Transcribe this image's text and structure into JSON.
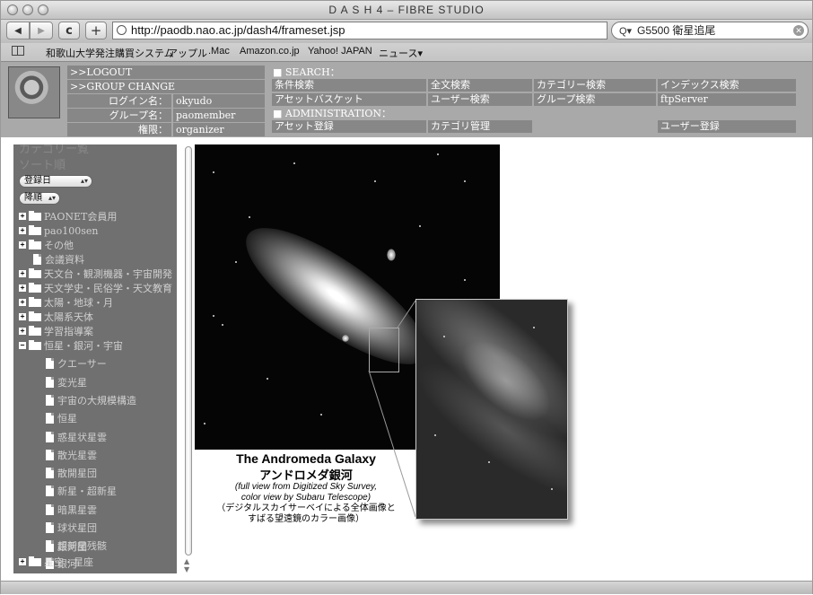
{
  "window": {
    "title": "D A S H 4 – FIBRE STUDIO"
  },
  "toolbar": {
    "back": "◀",
    "forward": "▶",
    "reload": "c",
    "add": "+",
    "url": "http://paodb.nao.ac.jp/dash4/frameset.jsp",
    "search_value": "G5500  衛星追尾"
  },
  "bookmarks": [
    "和歌山大学発注購買システム",
    "アップル",
    ".Mac",
    "Amazon.co.jp",
    "Yahoo! JAPAN",
    "ニュース▾"
  ],
  "user": {
    "logout": ">>LOGOUT",
    "group_change": ">>GROUP CHANGE",
    "login_label": "ログイン名：",
    "login_value": "okyudo",
    "group_label": "グループ名：",
    "group_value": "paomember",
    "role_label": "権限：",
    "role_value": "organizer"
  },
  "menu": {
    "search_title": "■ SEARCH：",
    "search_items": [
      "条件検索",
      "全文検索",
      "カテゴリー検索",
      "インデックス検索",
      "アセットバスケット",
      "ユーザー検索",
      "グループ検索",
      "ftpServer"
    ],
    "admin_title": "■ ADMINISTRATION：",
    "admin_items": [
      "アセット登録",
      "カテゴリ管理",
      "ユーザー登録"
    ]
  },
  "sidebar": {
    "heading1": "カテゴリー覧",
    "heading2": "ソート順",
    "sort_field": "登録日",
    "sort_order": "降順",
    "tree": [
      "PAONET会員用",
      "pao100sen",
      "その他",
      "会議資料",
      "天文台・観測機器・宇宙開発",
      "天文学史・民俗学・天文教育",
      "太陽・地球・月",
      "太陽系天体",
      "学習指導案",
      "恒星・銀河・宇宙",
      "クエーサー",
      "変光星",
      "宇宙の大規模構造",
      "恒星",
      "惑星状星雲",
      "散光星雲",
      "散開星団",
      "新星・超新星",
      "暗黒星雲",
      "球状星団",
      "超新星残骸",
      "銀河",
      "銀河団",
      "星空・星座"
    ]
  },
  "image": {
    "title_en": "The Andromeda Galaxy",
    "title_jp": "アンドロメダ銀河",
    "sub1": "(full view from Digitized Sky Survey,",
    "sub2": "color view by Subaru Telescope)",
    "sub_jp1": "（デジタルスカイサーベイによる全体画像と",
    "sub_jp2": "すばる望遠鏡のカラー画像）"
  }
}
